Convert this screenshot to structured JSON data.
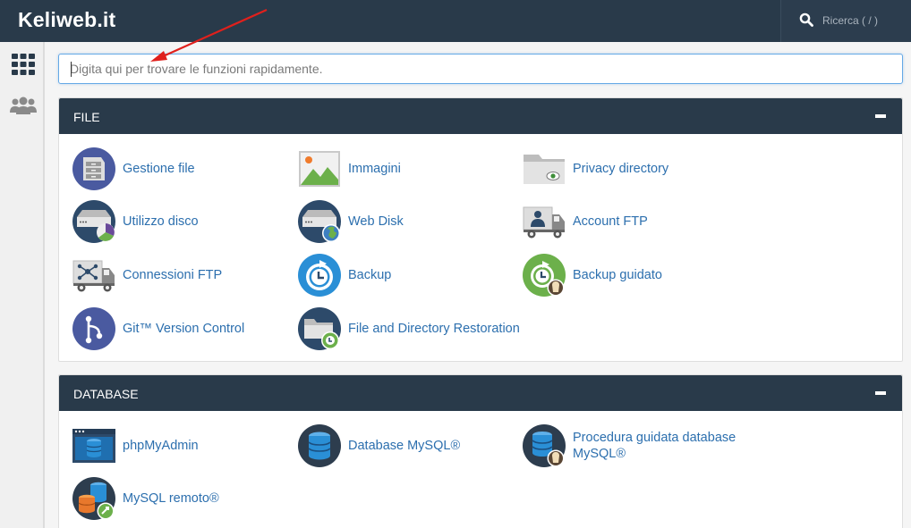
{
  "header": {
    "brand": "Keliweb.it",
    "search_placeholder": "Ricerca ( / )",
    "search_icon": "search-icon"
  },
  "sidebar": {
    "items": [
      {
        "icon": "grid-icon"
      },
      {
        "icon": "users-icon"
      }
    ]
  },
  "tool_search": {
    "placeholder": "Digita qui per trovare le funzioni rapidamente."
  },
  "sections": {
    "file": {
      "title": "FILE",
      "items": [
        {
          "label": "Gestione file",
          "icon": "file-manager-icon"
        },
        {
          "label": "Immagini",
          "icon": "images-icon"
        },
        {
          "label": "Privacy directory",
          "icon": "directory-privacy-icon"
        },
        {
          "label": "Utilizzo disco",
          "icon": "disk-usage-icon"
        },
        {
          "label": "Web Disk",
          "icon": "web-disk-icon"
        },
        {
          "label": "Account FTP",
          "icon": "ftp-accounts-icon"
        },
        {
          "label": "Connessioni FTP",
          "icon": "ftp-connections-icon"
        },
        {
          "label": "Backup",
          "icon": "backup-icon"
        },
        {
          "label": "Backup guidato",
          "icon": "backup-wizard-icon"
        },
        {
          "label": "Git™ Version Control",
          "icon": "git-icon"
        },
        {
          "label": "File and Directory Restoration",
          "icon": "file-restoration-icon"
        }
      ]
    },
    "database": {
      "title": "DATABASE",
      "items": [
        {
          "label": "phpMyAdmin",
          "icon": "phpmyadmin-icon"
        },
        {
          "label": "Database MySQL®",
          "icon": "mysql-databases-icon"
        },
        {
          "label": "Procedura guidata database MySQL®",
          "icon": "mysql-wizard-icon"
        },
        {
          "label": "MySQL remoto®",
          "icon": "remote-mysql-icon"
        }
      ]
    }
  },
  "colors": {
    "header_bg": "#293a4a",
    "link": "#2c6fae",
    "annotation_arrow": "#e0201c"
  }
}
